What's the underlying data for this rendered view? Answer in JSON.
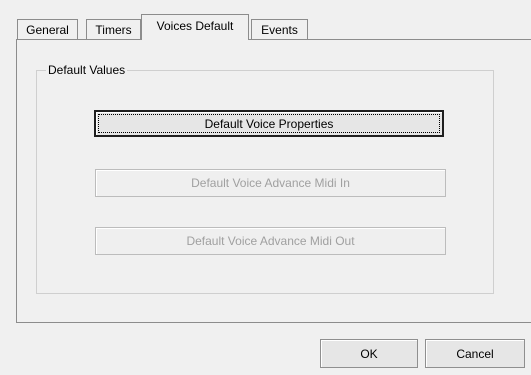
{
  "tabs": [
    {
      "label": "General",
      "active": false
    },
    {
      "label": "Timers",
      "active": false
    },
    {
      "label": "Voices Default",
      "active": true
    },
    {
      "label": "Events",
      "active": false
    }
  ],
  "group": {
    "title": "Default Values",
    "buttons": {
      "properties": "Default Voice Properties",
      "midi_in": "Default Voice Advance Midi In",
      "midi_out": "Default Voice Advance Midi Out"
    }
  },
  "footer": {
    "ok": "OK",
    "cancel": "Cancel"
  },
  "colors": {
    "background": "#f0f0f0",
    "disabled_text": "#a0a0a0",
    "border": "#8c8c8c"
  }
}
